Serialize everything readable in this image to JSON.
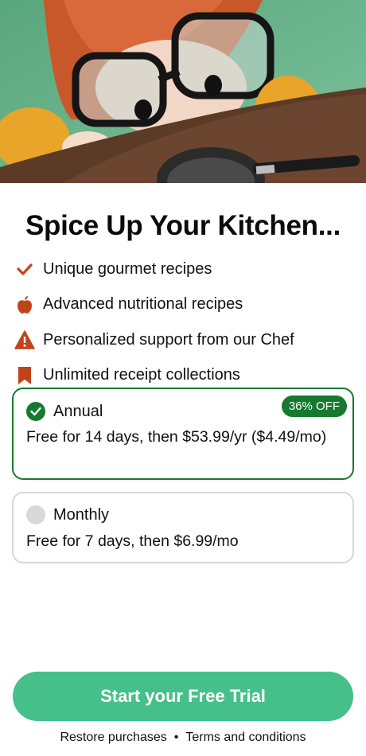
{
  "hero": {
    "image_subject": "cartoon child with big glasses peeking over a table next to a frying pan"
  },
  "title": "Spice Up Your Kitchen...",
  "features": [
    {
      "label": "Unique gourmet recipes",
      "icon": "checkmark-icon"
    },
    {
      "label": "Advanced nutritional recipes",
      "icon": "apple-icon"
    },
    {
      "label": "Personalized support from our Chef",
      "icon": "warning-icon"
    },
    {
      "label": "Unlimited receipt collections",
      "icon": "bookmark-icon"
    }
  ],
  "plans": {
    "annual": {
      "name": "Annual",
      "desc": "Free for 14 days, then $53.99/yr ($4.49/mo)",
      "badge": "36% OFF",
      "selected": true
    },
    "monthly": {
      "name": "Monthly",
      "desc": "Free for 7 days, then $6.99/mo",
      "selected": false
    }
  },
  "cta": "Start your Free Trial",
  "footer": {
    "restore": "Restore purchases",
    "separator": "•",
    "terms": "Terms and conditions"
  },
  "colors": {
    "accent_green": "#167a2e",
    "cta_green": "#45c08a",
    "icon_orange": "#c0441a"
  }
}
